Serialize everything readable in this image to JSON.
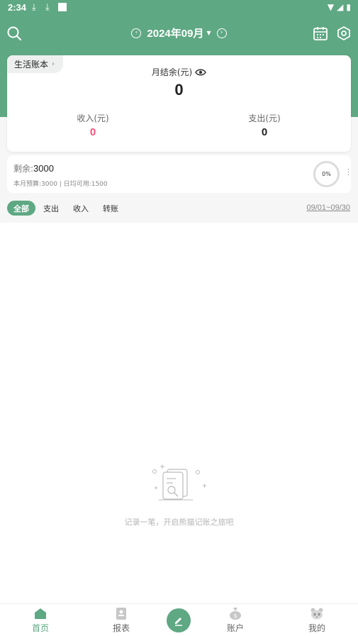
{
  "status_bar": {
    "time": "2:34"
  },
  "top_bar": {
    "month_title": "2024年09月"
  },
  "summary": {
    "book_name": "生活账本",
    "balance_label": "月结余(元)",
    "balance_value": "0",
    "income_label": "收入(元)",
    "income_value": "0",
    "expense_label": "支出(元)",
    "expense_value": "0",
    "income_color": "#f0507a"
  },
  "budget": {
    "remaining_label": "剩余:",
    "remaining_value": "3000",
    "detail": "本月预算:3000 | 日均可用:1500",
    "progress_text": "0%",
    "progress_fraction": 0
  },
  "filters": {
    "tabs": [
      {
        "label": "全部",
        "active": true
      },
      {
        "label": "支出",
        "active": false
      },
      {
        "label": "收入",
        "active": false
      },
      {
        "label": "转账",
        "active": false
      }
    ],
    "date_range": "09/01~09/30"
  },
  "empty_state": {
    "text": "记录一笔，开启熊猫记账之旅吧"
  },
  "bottom_nav": {
    "items": [
      {
        "label": "首页",
        "icon": "home-icon",
        "active": true
      },
      {
        "label": "报表",
        "icon": "report-icon",
        "active": false
      },
      {
        "label": "",
        "icon": "edit-icon",
        "active": false
      },
      {
        "label": "账户",
        "icon": "wallet-icon",
        "active": false
      },
      {
        "label": "我的",
        "icon": "panda-icon",
        "active": false
      }
    ]
  },
  "colors": {
    "accent": "#5ea883",
    "background": "#f5f6f5"
  }
}
